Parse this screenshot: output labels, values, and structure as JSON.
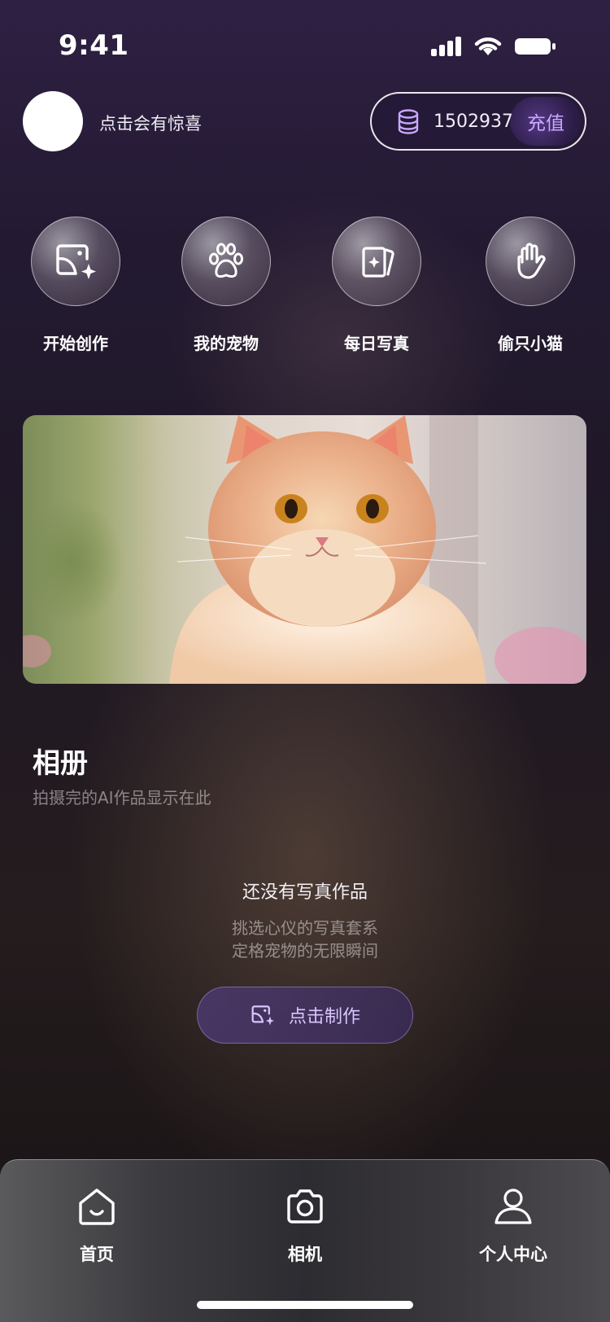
{
  "status_bar": {
    "time": "9:41"
  },
  "header": {
    "avatar_caption": "点击会有惊喜",
    "coin_balance": "1502937",
    "recharge_label": "充值"
  },
  "quick_actions": [
    {
      "label": "开始创作",
      "icon": "image-sparkle-icon"
    },
    {
      "label": "我的宠物",
      "icon": "paw-icon"
    },
    {
      "label": "每日写真",
      "icon": "photo-card-icon"
    },
    {
      "label": "偷只小猫",
      "icon": "hand-icon"
    }
  ],
  "album": {
    "title": "相册",
    "subtitle": "拍摄完的AI作品显示在此",
    "empty_title": "还没有写真作品",
    "empty_line1": "挑选心仪的写真套系",
    "empty_line2": "定格宠物的无限瞬间",
    "make_button_label": "点击制作"
  },
  "tab_bar": [
    {
      "label": "首页",
      "icon": "home-icon",
      "active": true
    },
    {
      "label": "相机",
      "icon": "camera-icon",
      "active": false
    },
    {
      "label": "个人中心",
      "icon": "person-icon",
      "active": false
    }
  ],
  "colors": {
    "accent": "#c9a8ff",
    "background": "#231a32"
  }
}
